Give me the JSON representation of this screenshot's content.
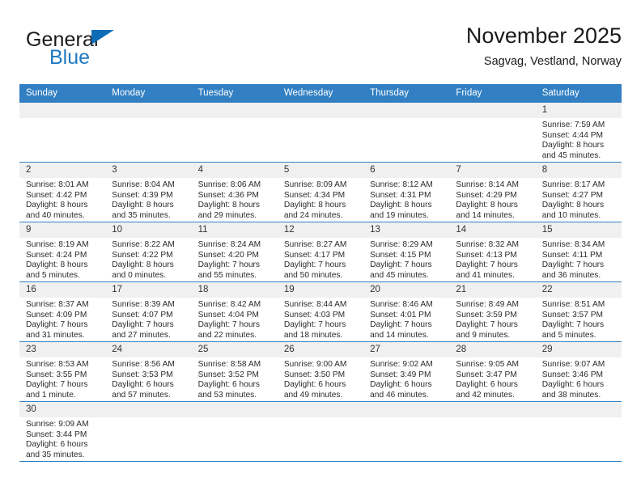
{
  "brand": {
    "line1": "General",
    "line2": "Blue",
    "triangle_icon": "triangle-icon",
    "color_primary": "#1f78c1",
    "color_text": "#1a1a1a"
  },
  "header": {
    "title": "November 2025",
    "subtitle": "Sagvag, Vestland, Norway"
  },
  "theme": {
    "header_bg": "#3280c3",
    "header_text": "#ffffff",
    "daynum_bg": "#f0f0f0",
    "cell_bg": "#ffffff",
    "row_divider": "#3280c3"
  },
  "weekdays": [
    "Sunday",
    "Monday",
    "Tuesday",
    "Wednesday",
    "Thursday",
    "Friday",
    "Saturday"
  ],
  "weeks": [
    [
      {
        "day": "",
        "sunrise": "",
        "sunset": "",
        "daylight1": "",
        "daylight2": "",
        "blank": true
      },
      {
        "day": "",
        "sunrise": "",
        "sunset": "",
        "daylight1": "",
        "daylight2": "",
        "blank": true
      },
      {
        "day": "",
        "sunrise": "",
        "sunset": "",
        "daylight1": "",
        "daylight2": "",
        "blank": true
      },
      {
        "day": "",
        "sunrise": "",
        "sunset": "",
        "daylight1": "",
        "daylight2": "",
        "blank": true
      },
      {
        "day": "",
        "sunrise": "",
        "sunset": "",
        "daylight1": "",
        "daylight2": "",
        "blank": true
      },
      {
        "day": "",
        "sunrise": "",
        "sunset": "",
        "daylight1": "",
        "daylight2": "",
        "blank": true
      },
      {
        "day": "1",
        "sunrise": "Sunrise: 7:59 AM",
        "sunset": "Sunset: 4:44 PM",
        "daylight1": "Daylight: 8 hours",
        "daylight2": "and 45 minutes.",
        "blank": false
      }
    ],
    [
      {
        "day": "2",
        "sunrise": "Sunrise: 8:01 AM",
        "sunset": "Sunset: 4:42 PM",
        "daylight1": "Daylight: 8 hours",
        "daylight2": "and 40 minutes.",
        "blank": false
      },
      {
        "day": "3",
        "sunrise": "Sunrise: 8:04 AM",
        "sunset": "Sunset: 4:39 PM",
        "daylight1": "Daylight: 8 hours",
        "daylight2": "and 35 minutes.",
        "blank": false
      },
      {
        "day": "4",
        "sunrise": "Sunrise: 8:06 AM",
        "sunset": "Sunset: 4:36 PM",
        "daylight1": "Daylight: 8 hours",
        "daylight2": "and 29 minutes.",
        "blank": false
      },
      {
        "day": "5",
        "sunrise": "Sunrise: 8:09 AM",
        "sunset": "Sunset: 4:34 PM",
        "daylight1": "Daylight: 8 hours",
        "daylight2": "and 24 minutes.",
        "blank": false
      },
      {
        "day": "6",
        "sunrise": "Sunrise: 8:12 AM",
        "sunset": "Sunset: 4:31 PM",
        "daylight1": "Daylight: 8 hours",
        "daylight2": "and 19 minutes.",
        "blank": false
      },
      {
        "day": "7",
        "sunrise": "Sunrise: 8:14 AM",
        "sunset": "Sunset: 4:29 PM",
        "daylight1": "Daylight: 8 hours",
        "daylight2": "and 14 minutes.",
        "blank": false
      },
      {
        "day": "8",
        "sunrise": "Sunrise: 8:17 AM",
        "sunset": "Sunset: 4:27 PM",
        "daylight1": "Daylight: 8 hours",
        "daylight2": "and 10 minutes.",
        "blank": false
      }
    ],
    [
      {
        "day": "9",
        "sunrise": "Sunrise: 8:19 AM",
        "sunset": "Sunset: 4:24 PM",
        "daylight1": "Daylight: 8 hours",
        "daylight2": "and 5 minutes.",
        "blank": false
      },
      {
        "day": "10",
        "sunrise": "Sunrise: 8:22 AM",
        "sunset": "Sunset: 4:22 PM",
        "daylight1": "Daylight: 8 hours",
        "daylight2": "and 0 minutes.",
        "blank": false
      },
      {
        "day": "11",
        "sunrise": "Sunrise: 8:24 AM",
        "sunset": "Sunset: 4:20 PM",
        "daylight1": "Daylight: 7 hours",
        "daylight2": "and 55 minutes.",
        "blank": false
      },
      {
        "day": "12",
        "sunrise": "Sunrise: 8:27 AM",
        "sunset": "Sunset: 4:17 PM",
        "daylight1": "Daylight: 7 hours",
        "daylight2": "and 50 minutes.",
        "blank": false
      },
      {
        "day": "13",
        "sunrise": "Sunrise: 8:29 AM",
        "sunset": "Sunset: 4:15 PM",
        "daylight1": "Daylight: 7 hours",
        "daylight2": "and 45 minutes.",
        "blank": false
      },
      {
        "day": "14",
        "sunrise": "Sunrise: 8:32 AM",
        "sunset": "Sunset: 4:13 PM",
        "daylight1": "Daylight: 7 hours",
        "daylight2": "and 41 minutes.",
        "blank": false
      },
      {
        "day": "15",
        "sunrise": "Sunrise: 8:34 AM",
        "sunset": "Sunset: 4:11 PM",
        "daylight1": "Daylight: 7 hours",
        "daylight2": "and 36 minutes.",
        "blank": false
      }
    ],
    [
      {
        "day": "16",
        "sunrise": "Sunrise: 8:37 AM",
        "sunset": "Sunset: 4:09 PM",
        "daylight1": "Daylight: 7 hours",
        "daylight2": "and 31 minutes.",
        "blank": false
      },
      {
        "day": "17",
        "sunrise": "Sunrise: 8:39 AM",
        "sunset": "Sunset: 4:07 PM",
        "daylight1": "Daylight: 7 hours",
        "daylight2": "and 27 minutes.",
        "blank": false
      },
      {
        "day": "18",
        "sunrise": "Sunrise: 8:42 AM",
        "sunset": "Sunset: 4:04 PM",
        "daylight1": "Daylight: 7 hours",
        "daylight2": "and 22 minutes.",
        "blank": false
      },
      {
        "day": "19",
        "sunrise": "Sunrise: 8:44 AM",
        "sunset": "Sunset: 4:03 PM",
        "daylight1": "Daylight: 7 hours",
        "daylight2": "and 18 minutes.",
        "blank": false
      },
      {
        "day": "20",
        "sunrise": "Sunrise: 8:46 AM",
        "sunset": "Sunset: 4:01 PM",
        "daylight1": "Daylight: 7 hours",
        "daylight2": "and 14 minutes.",
        "blank": false
      },
      {
        "day": "21",
        "sunrise": "Sunrise: 8:49 AM",
        "sunset": "Sunset: 3:59 PM",
        "daylight1": "Daylight: 7 hours",
        "daylight2": "and 9 minutes.",
        "blank": false
      },
      {
        "day": "22",
        "sunrise": "Sunrise: 8:51 AM",
        "sunset": "Sunset: 3:57 PM",
        "daylight1": "Daylight: 7 hours",
        "daylight2": "and 5 minutes.",
        "blank": false
      }
    ],
    [
      {
        "day": "23",
        "sunrise": "Sunrise: 8:53 AM",
        "sunset": "Sunset: 3:55 PM",
        "daylight1": "Daylight: 7 hours",
        "daylight2": "and 1 minute.",
        "blank": false
      },
      {
        "day": "24",
        "sunrise": "Sunrise: 8:56 AM",
        "sunset": "Sunset: 3:53 PM",
        "daylight1": "Daylight: 6 hours",
        "daylight2": "and 57 minutes.",
        "blank": false
      },
      {
        "day": "25",
        "sunrise": "Sunrise: 8:58 AM",
        "sunset": "Sunset: 3:52 PM",
        "daylight1": "Daylight: 6 hours",
        "daylight2": "and 53 minutes.",
        "blank": false
      },
      {
        "day": "26",
        "sunrise": "Sunrise: 9:00 AM",
        "sunset": "Sunset: 3:50 PM",
        "daylight1": "Daylight: 6 hours",
        "daylight2": "and 49 minutes.",
        "blank": false
      },
      {
        "day": "27",
        "sunrise": "Sunrise: 9:02 AM",
        "sunset": "Sunset: 3:49 PM",
        "daylight1": "Daylight: 6 hours",
        "daylight2": "and 46 minutes.",
        "blank": false
      },
      {
        "day": "28",
        "sunrise": "Sunrise: 9:05 AM",
        "sunset": "Sunset: 3:47 PM",
        "daylight1": "Daylight: 6 hours",
        "daylight2": "and 42 minutes.",
        "blank": false
      },
      {
        "day": "29",
        "sunrise": "Sunrise: 9:07 AM",
        "sunset": "Sunset: 3:46 PM",
        "daylight1": "Daylight: 6 hours",
        "daylight2": "and 38 minutes.",
        "blank": false
      }
    ],
    [
      {
        "day": "30",
        "sunrise": "Sunrise: 9:09 AM",
        "sunset": "Sunset: 3:44 PM",
        "daylight1": "Daylight: 6 hours",
        "daylight2": "and 35 minutes.",
        "blank": false
      },
      {
        "day": "",
        "sunrise": "",
        "sunset": "",
        "daylight1": "",
        "daylight2": "",
        "blank": true
      },
      {
        "day": "",
        "sunrise": "",
        "sunset": "",
        "daylight1": "",
        "daylight2": "",
        "blank": true
      },
      {
        "day": "",
        "sunrise": "",
        "sunset": "",
        "daylight1": "",
        "daylight2": "",
        "blank": true
      },
      {
        "day": "",
        "sunrise": "",
        "sunset": "",
        "daylight1": "",
        "daylight2": "",
        "blank": true
      },
      {
        "day": "",
        "sunrise": "",
        "sunset": "",
        "daylight1": "",
        "daylight2": "",
        "blank": true
      },
      {
        "day": "",
        "sunrise": "",
        "sunset": "",
        "daylight1": "",
        "daylight2": "",
        "blank": true
      }
    ]
  ]
}
